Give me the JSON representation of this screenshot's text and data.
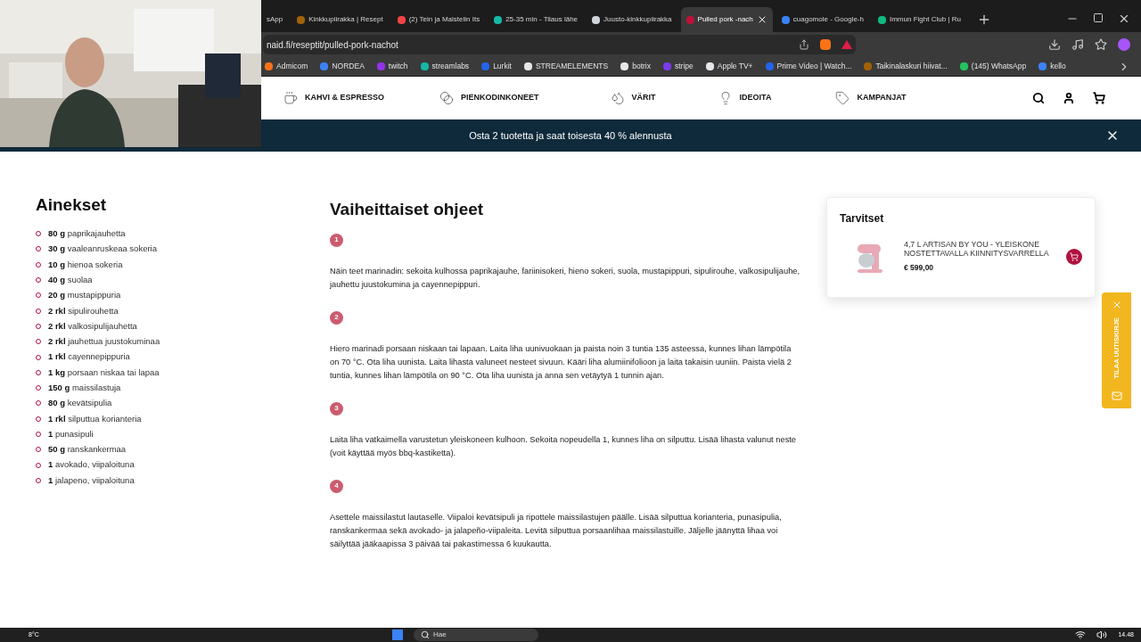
{
  "browser": {
    "tabs": [
      {
        "label": "sApp",
        "selected": false
      },
      {
        "label": "Kinkkupiirakka | Resept",
        "selected": false
      },
      {
        "label": "(2) Tein ja Maistelin Its",
        "selected": false
      },
      {
        "label": "25-35 min - Tilaus lähe",
        "selected": false
      },
      {
        "label": "Juusto-kinkkupiirakka",
        "selected": false
      },
      {
        "label": "Pulled pork -nach",
        "selected": true
      },
      {
        "label": "cuagomole - Google-h",
        "selected": false
      },
      {
        "label": "Immun Fight Club | Ru",
        "selected": false
      }
    ],
    "url": "naid.fi/reseptit/pulled-pork-nachot",
    "bookmarks": [
      "Admicom",
      "NORDEA",
      "twitch",
      "streamlabs",
      "Lurkit",
      "STREAMELEMENTS",
      "botrix",
      "stripe",
      "Apple TV+",
      "Prime Video | Watch...",
      "Taikinalaskuri hiivat...",
      "(145) WhatsApp",
      "kello"
    ]
  },
  "site_nav": [
    "KAHVI & ESPRESSO",
    "PIENKODINKONEET",
    "VÄRIT",
    "IDEOITA",
    "KAMPANJAT"
  ],
  "promo_banner": "Osta 2 tuotetta ja saat toisesta 40 % alennusta",
  "ingredients": {
    "title": "Ainekset",
    "items": [
      {
        "amount": "80 g",
        "name": "paprikajauhetta"
      },
      {
        "amount": "30 g",
        "name": "vaaleanruskeaa sokeria"
      },
      {
        "amount": "10 g",
        "name": "hienoa sokeria"
      },
      {
        "amount": "40 g",
        "name": "suolaa"
      },
      {
        "amount": "20 g",
        "name": "mustapippuria"
      },
      {
        "amount": "2 rkl",
        "name": "sipulirouhetta"
      },
      {
        "amount": "2 rkl",
        "name": "valkosipulijauhetta"
      },
      {
        "amount": "2 rkl",
        "name": "jauhettua juustokuminaa"
      },
      {
        "amount": "1 rkl",
        "name": "cayennepippuria"
      },
      {
        "amount": "1 kg",
        "name": "porsaan niskaa tai lapaa"
      },
      {
        "amount": "150 g",
        "name": "maissilastuja"
      },
      {
        "amount": "80 g",
        "name": "kevätsipulia"
      },
      {
        "amount": "1 rkl",
        "name": "silputtua korianteria"
      },
      {
        "amount": "1",
        "name": "punasipuli"
      },
      {
        "amount": "50 g",
        "name": "ranskankermaa"
      },
      {
        "amount": "1",
        "name": "avokado, viipaloituna"
      },
      {
        "amount": "1",
        "name": "jalapeno, viipaloituna"
      }
    ]
  },
  "instructions": {
    "title": "Vaiheittaiset ohjeet",
    "steps": [
      {
        "number": "1",
        "text": "Näin teet marinadin: sekoita kulhossa paprikajauhe, fariinisokeri, hieno sokeri, suola, mustapippuri, sipulirouhe, valkosipulijauhe, jauhettu juustokumina ja cayennepippuri."
      },
      {
        "number": "2",
        "text": "Hiero marinadi porsaan niskaan tai lapaan. Laita liha uunivuokaan ja paista noin 3 tuntia 135 asteessa, kunnes lihan lämpötila on 70 °C. Ota liha uunista. Laita lihasta valuneet nesteet sivuun. Kääri liha alumiinifolioon ja laita takaisin uuniin. Paista vielä 2 tuntia, kunnes lihan lämpötila on 90 °C. Ota liha uunista ja anna sen vetäytyä 1 tunnin ajan."
      },
      {
        "number": "3",
        "text": "Laita liha vatkaimella varustetun yleiskoneen kulhoon. Sekoita nopeudella 1, kunnes liha on silputtu. Lisää lihasta valunut neste (voit käyttää myös bbq-kastiketta)."
      },
      {
        "number": "4",
        "text": "Asettele maissilastut lautaselle. Viipaloi kevätsipuli ja ripottele maissilastujen päälle. Lisää silputtua korianteria, punasipulia, ranskankermaa sekä avokado- ja jalapeño-viipaleita. Levitä silputtua porsaanlihaa maissilastuille. Jäljelle jäänyttä lihaa voi säilyttää jääkaapissa 3 päivää tai pakastimessa 6 kuukautta."
      }
    ]
  },
  "supplies": {
    "title": "Tarvitset",
    "product": {
      "name": "4,7 L ARTISAN BY YOU - YLEISKONE NOSTETTAVALLA KIINNITYSVARRELLA",
      "price": "€ 599,00"
    }
  },
  "newsletter_tab": "TILAA UUTISKIRJE",
  "taskbar": {
    "weather": "8°C",
    "search_placeholder": "Hae",
    "time": "14.48"
  }
}
